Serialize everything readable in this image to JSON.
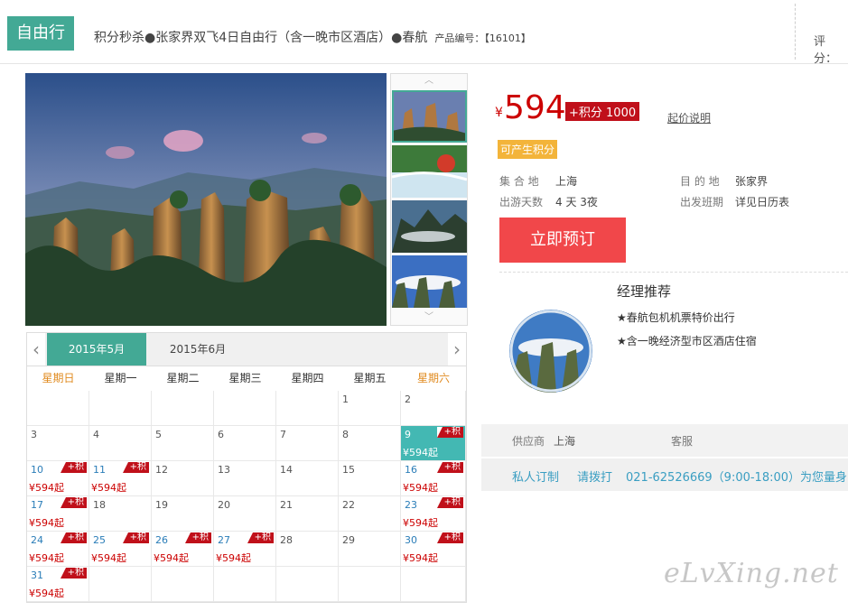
{
  "header": {
    "tag": "自由行",
    "title": "积分秒杀●张家界双飞4日自由行（含一晚市区酒店）●春航",
    "product_no_label": "产品编号：",
    "product_no": "【16101】",
    "score_label": "评分："
  },
  "calendar": {
    "tabs": [
      "2015年5月",
      "2015年6月"
    ],
    "weekdays": [
      "星期日",
      "星期一",
      "星期二",
      "星期三",
      "星期四",
      "星期五",
      "星期六"
    ],
    "points_badge": "+积",
    "price_text": "¥594起",
    "days": [
      {
        "d": "1"
      },
      {
        "d": "2"
      },
      {
        "d": "3"
      },
      {
        "d": "4"
      },
      {
        "d": "5"
      },
      {
        "d": "6"
      },
      {
        "d": "7"
      },
      {
        "d": "8"
      },
      {
        "d": "9",
        "avail": true
      },
      {
        "d": "10",
        "avail": true
      },
      {
        "d": "11",
        "avail": true
      },
      {
        "d": "12"
      },
      {
        "d": "13"
      },
      {
        "d": "14"
      },
      {
        "d": "15"
      },
      {
        "d": "16",
        "avail": true
      },
      {
        "d": "17",
        "avail": true
      },
      {
        "d": "18"
      },
      {
        "d": "19"
      },
      {
        "d": "20"
      },
      {
        "d": "21"
      },
      {
        "d": "22"
      },
      {
        "d": "23",
        "avail": true
      },
      {
        "d": "24",
        "avail": true
      },
      {
        "d": "25",
        "avail": true
      },
      {
        "d": "26",
        "avail": true
      },
      {
        "d": "27",
        "avail": true
      },
      {
        "d": "28"
      },
      {
        "d": "29"
      },
      {
        "d": "30",
        "avail": true
      },
      {
        "d": "31",
        "avail": true
      }
    ],
    "first_weekday": 5,
    "highlight_day": "9"
  },
  "price": {
    "currency": "¥",
    "amount": "594",
    "points": "+积分 1000",
    "note": "起价说明",
    "earn_points": "可产生积分"
  },
  "info": {
    "depart_label": "集 合 地",
    "depart": "上海",
    "dest_label": "目 的 地",
    "dest": "张家界",
    "days_label": "出游天数",
    "days": "4 天 3夜",
    "schedule_label": "出发班期",
    "schedule": "详见日历表"
  },
  "book_label": "立即预订",
  "manager": {
    "title": "经理推荐",
    "items": [
      "★春航包机机票特价出行",
      "★含一晚经济型市区酒店住宿"
    ]
  },
  "supplier": {
    "label": "供应商",
    "value": "上海",
    "service_label": "客服"
  },
  "contact": {
    "custom": "私人订制",
    "call": "请拨打",
    "phone": "021-62526669（9:00-18:00）为您量身"
  },
  "watermark": "eLvXing.net",
  "colors": {
    "accent": "#43a995",
    "price": "#cc0000",
    "book": "#f1474a"
  }
}
